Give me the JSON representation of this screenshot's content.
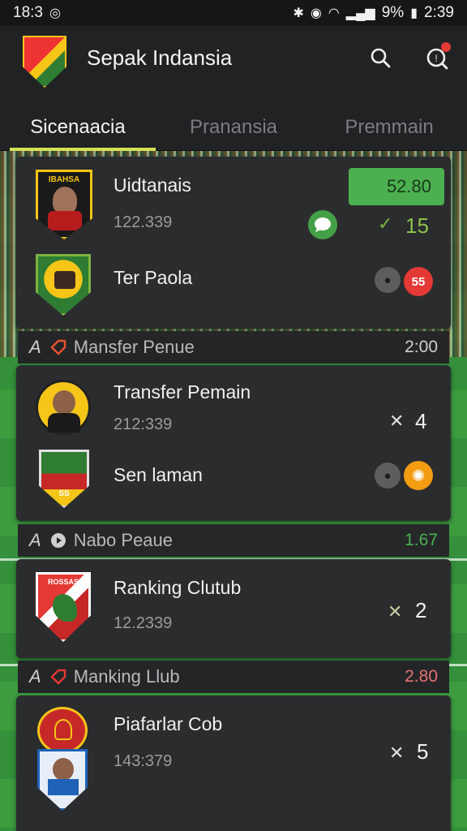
{
  "status": {
    "time_left": "18:3",
    "battery_pct": "9%",
    "time_right": "2:39"
  },
  "app": {
    "title": "Sepak Indansia"
  },
  "tabs": [
    {
      "label": "Sicenaacia",
      "active": true
    },
    {
      "label": "Pranansia",
      "active": false
    },
    {
      "label": "Premmain",
      "active": false
    }
  ],
  "cards": [
    {
      "rows": [
        {
          "name": "Uidtanais",
          "sub": "122.339",
          "badge": "52.80",
          "score": "15"
        },
        {
          "name": "Ter Paola",
          "badge": "55"
        }
      ]
    },
    {
      "section": {
        "letter": "A",
        "title": "Mansfer Penue",
        "value": "2:00"
      },
      "rows": [
        {
          "name": "Transfer Pemain",
          "sub": "212:339",
          "score": "4"
        },
        {
          "name": "Sen laman"
        }
      ]
    },
    {
      "section": {
        "letter": "A",
        "title": "Nabo Peaue",
        "value": "1.67"
      },
      "rows": [
        {
          "name": "Ranking Clutub",
          "sub": "12.2339",
          "score": "2"
        }
      ]
    },
    {
      "section": {
        "letter": "A",
        "title": "Manking Llub",
        "value": "2.80"
      },
      "rows": [
        {
          "name": "Piafarlar Cob",
          "sub": "143:379",
          "score": "5"
        }
      ]
    }
  ],
  "crest_texts": [
    "IBAHSA",
    "ROSSAS",
    "SS"
  ],
  "colors": {
    "accent": "#d4e157",
    "green": "#4caf50",
    "red": "#e53935",
    "orange": "#f39c12"
  }
}
